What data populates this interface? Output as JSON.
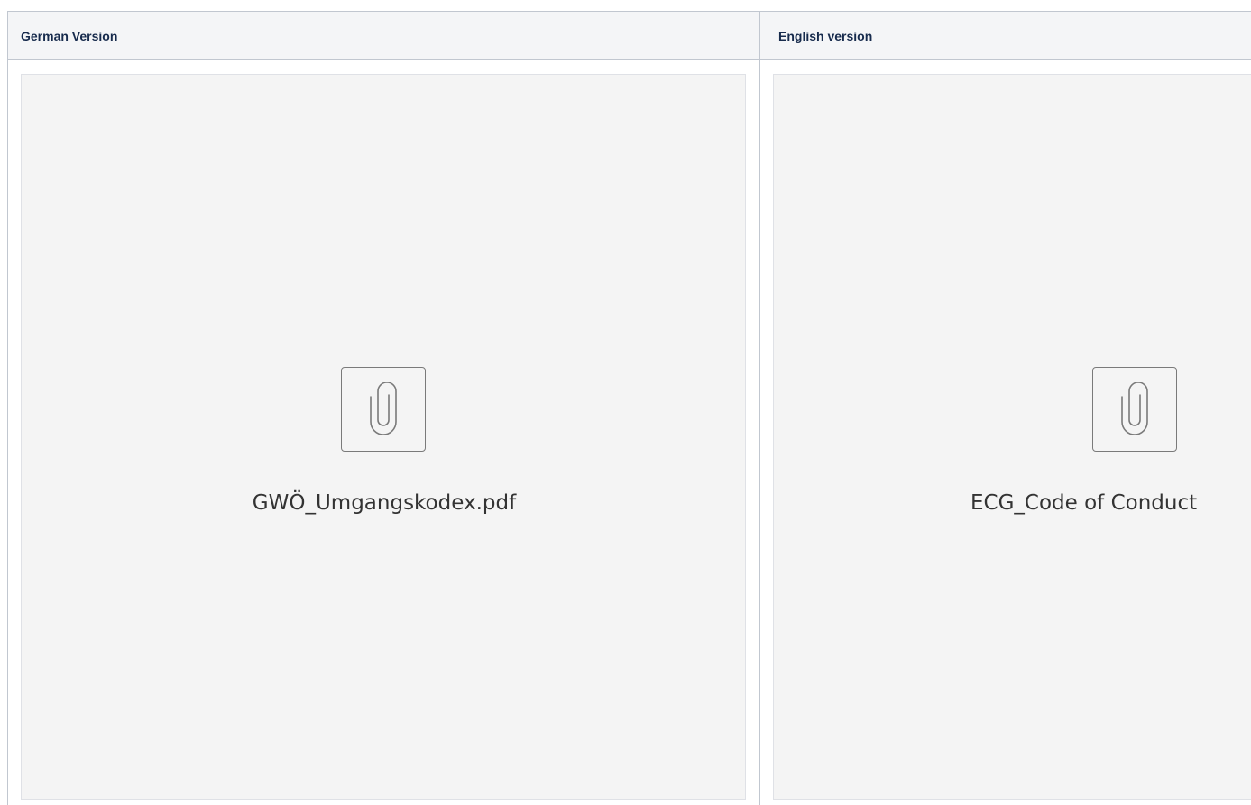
{
  "table": {
    "columns": [
      {
        "header": "German Version",
        "attachment": {
          "file_name": "GWÖ_Umgangskodex.pdf",
          "icon": "paperclip-icon"
        }
      },
      {
        "header": "English version",
        "attachment": {
          "file_name": "ECG_Code of Conduct",
          "icon": "paperclip-icon"
        }
      }
    ]
  },
  "colors": {
    "border": "#c1c7d0",
    "header_bg": "#f4f5f7",
    "preview_bg": "#f4f4f4",
    "icon_stroke": "#7a7a7a",
    "text": "#172b4d"
  }
}
